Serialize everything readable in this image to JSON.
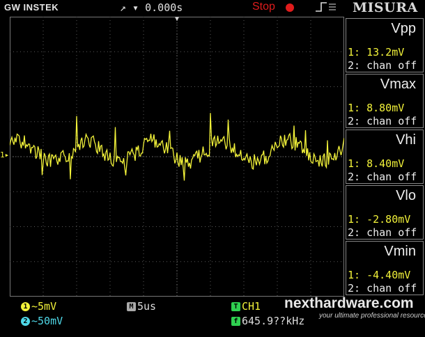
{
  "header": {
    "brand": "GW INSTEK",
    "trigger_readout": "↗ ▾ 0.000s",
    "run_state": "Stop",
    "title": "MISURA"
  },
  "channel_marker": "1",
  "measurements": [
    {
      "name": "Vpp",
      "ch1": "1: 13.2mV",
      "ch2": "2: chan off"
    },
    {
      "name": "Vmax",
      "ch1": "1: 8.80mV",
      "ch2": "2: chan off"
    },
    {
      "name": "Vhi",
      "ch1": "1: 8.40mV",
      "ch2": "2: chan off"
    },
    {
      "name": "Vlo",
      "ch1": "1: -2.80mV",
      "ch2": "2: chan off"
    },
    {
      "name": "Vmin",
      "ch1": "1: -4.40mV",
      "ch2": "2: chan off"
    }
  ],
  "footer": {
    "ch1_scale": "~5mV",
    "ch2_scale": "~50mV",
    "timebase": "5us",
    "trigger_source": "CH1",
    "frequency": "645.9??kHz"
  },
  "watermark": {
    "text": "nexthardware.com",
    "tagline": "your ultimate professional resource"
  },
  "colors": {
    "ch1": "#f2f23a",
    "ch2": "#4fd8e8",
    "grid": "#5a5a5a",
    "stop": "#e01c1c"
  }
}
